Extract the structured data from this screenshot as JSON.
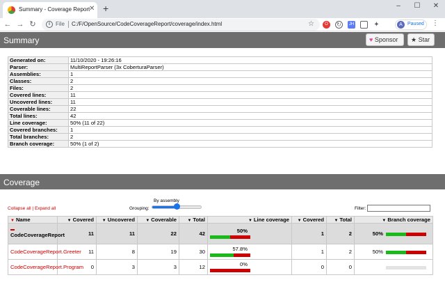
{
  "browser": {
    "tab_title": "Summary - Coverage Report",
    "new_tab_label": "+",
    "url_scheme": "File",
    "url": "C:/F/OpenSource/CodeCoverageReport/coverage/index.html",
    "profile_status": "Paused",
    "profile_initial": "A",
    "ext_icons": [
      "opera-icon",
      "refresh-icon",
      "jh-extension-icon",
      "card-extension-icon",
      "puzzle-extension-icon"
    ]
  },
  "header": {
    "title": "Summary",
    "sponsor_label": "Sponsor",
    "star_label": "Star"
  },
  "summary_rows": [
    {
      "key": "Generated on:",
      "value": "11/10/2020 - 19:26:16"
    },
    {
      "key": "Parser:",
      "value": "MultiReportParser (3x CoberturaParser)"
    },
    {
      "key": "Assemblies:",
      "value": "1"
    },
    {
      "key": "Classes:",
      "value": "2"
    },
    {
      "key": "Files:",
      "value": "2"
    },
    {
      "key": "Covered lines:",
      "value": "11"
    },
    {
      "key": "Uncovered lines:",
      "value": "11"
    },
    {
      "key": "Coverable lines:",
      "value": "22"
    },
    {
      "key": "Total lines:",
      "value": "42"
    },
    {
      "key": "Line coverage:",
      "value": "50% (11 of 22)"
    },
    {
      "key": "Covered branches:",
      "value": "1"
    },
    {
      "key": "Total branches:",
      "value": "2"
    },
    {
      "key": "Branch coverage:",
      "value": "50% (1 of 2)"
    }
  ],
  "coverage": {
    "title": "Coverage",
    "collapse_all": "Collapse all",
    "separator": "|",
    "expand_all": "Expand all",
    "grouping_label": "Grouping:",
    "grouping_value": "By assembly",
    "grouping_level": 0.5,
    "filter_label": "Filter:",
    "filter_value": "",
    "columns": [
      "Name",
      "Covered",
      "Uncovered",
      "Coverable",
      "Total",
      "Line coverage",
      "Covered",
      "Total",
      "Branch coverage"
    ],
    "rows": [
      {
        "type": "assembly",
        "name": "CodeCoverageReport",
        "covered": "11",
        "uncovered": "11",
        "coverable": "22",
        "total": "42",
        "line_pct": "50%",
        "line_frac": 0.5,
        "br_covered": "1",
        "br_total": "2",
        "br_pct": "50%",
        "br_frac": 0.5
      },
      {
        "type": "class",
        "name": "CodeCoverageReport.Greeter",
        "covered": "11",
        "uncovered": "8",
        "coverable": "19",
        "total": "30",
        "line_pct": "57.8%",
        "line_frac": 0.578,
        "br_covered": "1",
        "br_total": "2",
        "br_pct": "50%",
        "br_frac": 0.5
      },
      {
        "type": "class",
        "name": "CodeCoverageReport.Program",
        "covered": "0",
        "uncovered": "3",
        "coverable": "3",
        "total": "12",
        "line_pct": "0%",
        "line_frac": 0.0,
        "br_covered": "0",
        "br_total": "0",
        "br_pct": "",
        "br_frac": null
      }
    ]
  }
}
